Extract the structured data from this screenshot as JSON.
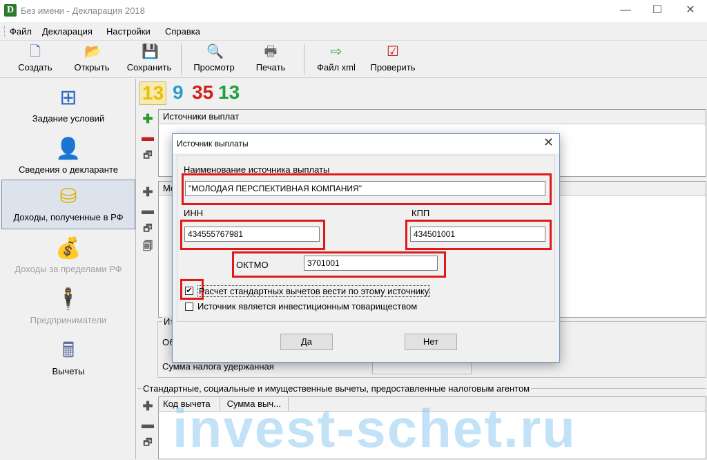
{
  "window": {
    "title": "Без имени - Декларация 2018",
    "app_icon_glyph": "D",
    "minimize": "—",
    "maximize": "☐",
    "close": "✕"
  },
  "menu": [
    "Файл",
    "Декларация",
    "Настройки",
    "Справка"
  ],
  "toolbar": {
    "create": "Создать",
    "open": "Открыть",
    "save": "Сохранить",
    "preview": "Просмотр",
    "print": "Печать",
    "xml": "Файл xml",
    "check": "Проверить"
  },
  "sidebar": [
    {
      "label": "Задание условий",
      "icon": "tree-icon",
      "state": "normal"
    },
    {
      "label": "Сведения о декларанте",
      "icon": "person-icon",
      "state": "normal"
    },
    {
      "label": "Доходы, полученные в РФ",
      "icon": "coins-icon",
      "state": "active"
    },
    {
      "label": "Доходы за пределами РФ",
      "icon": "money-bag-icon",
      "state": "disabled"
    },
    {
      "label": "Предприниматели",
      "icon": "businessman-icon",
      "state": "disabled"
    },
    {
      "label": "Вычеты",
      "icon": "calculator-icon",
      "state": "normal"
    }
  ],
  "tax_rates": [
    {
      "label": "13",
      "color": "#e8c000"
    },
    {
      "label": "9",
      "color": "#2aa0c8"
    },
    {
      "label": "35",
      "color": "#d02020"
    },
    {
      "label": "13",
      "color": "#20a040"
    }
  ],
  "sources_grid": {
    "header": "Источники выплат"
  },
  "income_grid": {
    "header_fragment": "Ме"
  },
  "totals": {
    "group_fragment": "Ит",
    "row_fragment": "Об",
    "tax_withheld": "Сумма налога удержанная"
  },
  "deductions": {
    "group_label": "Стандартные, социальные и имущественные вычеты, предоставленные налоговым агентом",
    "col_code": "Код вычета",
    "col_sum": "Сумма выч..."
  },
  "dialog": {
    "title": "Источник выплаты",
    "close": "✕",
    "name_label": "Наименование источника выплаты",
    "name_value": "\"МОЛОДАЯ ПЕРСПЕКТИВНАЯ КОМПАНИЯ\"",
    "inn_label": "ИНН",
    "inn_value": "434555767981",
    "kpp_label": "КПП",
    "kpp_value": "434501001",
    "oktmo_label": "ОКТМО",
    "oktmo_value": "3701001",
    "std_deductions_label": "Расчет стандартных вычетов вести по этому источнику",
    "std_deductions_checked": true,
    "check_mark": "✔",
    "investment_label": "Источник является инвестиционным товариществом",
    "investment_checked": false,
    "ok": "Да",
    "cancel": "Нет"
  },
  "watermark": "invest-schet.ru",
  "colors": {
    "highlight": "#e01818",
    "active_sidebar": "#dde3ec"
  }
}
